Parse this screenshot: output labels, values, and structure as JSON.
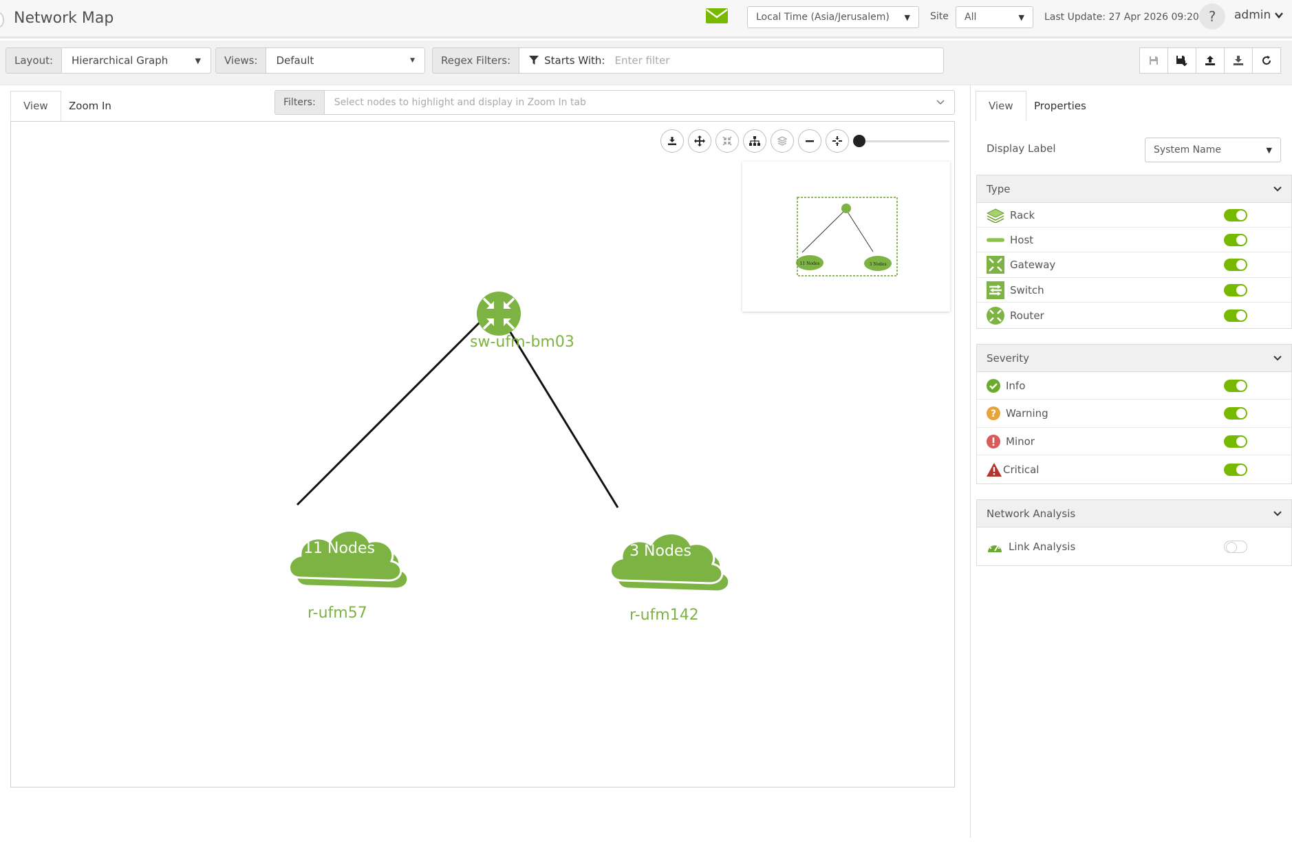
{
  "header": {
    "title": "Network Map",
    "timezone_select": "Local Time (Asia/Jerusalem)",
    "site_label": "Site",
    "site_select": "All",
    "last_update": "Last Update: 27 Apr 2026 09:20",
    "help": "?",
    "user": "admin"
  },
  "toolbar": {
    "layout_label": "Layout:",
    "layout_value": "Hierarchical Graph",
    "views_label": "Views:",
    "views_value": "Default",
    "regex_label": "Regex Filters:",
    "starts_with": "Starts With:",
    "filter_placeholder": "Enter filter"
  },
  "map_tabs": [
    "View",
    "Zoom In"
  ],
  "filters": {
    "label": "Filters:",
    "placeholder": "Select nodes to highlight and display in Zoom In tab"
  },
  "graph": {
    "router_label": "sw-ufm-bm03",
    "clouds": [
      {
        "count": "11 Nodes",
        "label": "r-ufm57"
      },
      {
        "count": "3 Nodes",
        "label": "r-ufm142"
      }
    ],
    "minimap_cloud_texts": [
      "11 Nodes",
      "3 Nodes"
    ]
  },
  "zoom_level": 0.0,
  "right_panel": {
    "tabs": [
      "View",
      "Properties"
    ],
    "display_label": "Display Label",
    "display_value": "System Name",
    "sections": {
      "type": {
        "title": "Type",
        "items": [
          {
            "label": "Rack",
            "on": true,
            "icon": "rack-icon"
          },
          {
            "label": "Host",
            "on": true,
            "icon": "host-icon"
          },
          {
            "label": "Gateway",
            "on": true,
            "icon": "gateway-icon"
          },
          {
            "label": "Switch",
            "on": true,
            "icon": "switch-icon"
          },
          {
            "label": "Router",
            "on": true,
            "icon": "router-icon"
          }
        ]
      },
      "severity": {
        "title": "Severity",
        "items": [
          {
            "label": "Info",
            "on": true,
            "icon": "info-check-icon"
          },
          {
            "label": "Warning",
            "on": true,
            "icon": "warning-icon"
          },
          {
            "label": "Minor",
            "on": true,
            "icon": "minor-icon"
          },
          {
            "label": "Critical",
            "on": true,
            "icon": "critical-icon"
          }
        ]
      },
      "network_analysis": {
        "title": "Network Analysis",
        "items": [
          {
            "label": "Link Analysis",
            "on": false,
            "icon": "gauge-icon"
          }
        ]
      }
    }
  },
  "colors": {
    "brand_green": "#76b900",
    "node_green": "#7cb342",
    "info": "#6aab2f",
    "warning": "#e8a33a",
    "minor": "#d95a5a",
    "critical": "#b5332c"
  }
}
